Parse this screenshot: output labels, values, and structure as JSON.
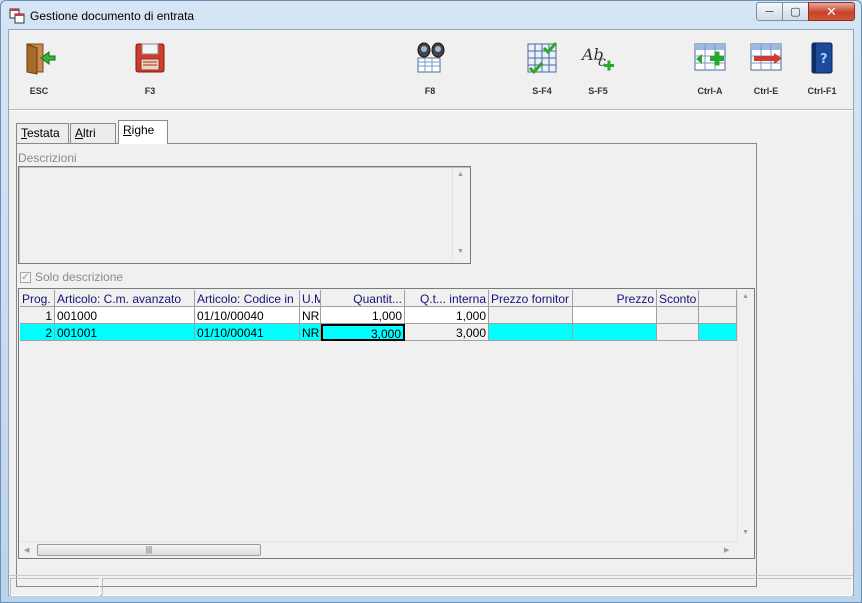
{
  "window": {
    "title": "Gestione documento di entrata",
    "minimize_glyph": "─",
    "maximize_glyph": "▢",
    "close_glyph": "✕"
  },
  "toolbar": {
    "buttons": [
      {
        "label": "ESC",
        "icon": "exit-door-icon"
      },
      {
        "label": "F3",
        "icon": "floppy-save-icon"
      },
      {
        "label": "F8",
        "icon": "binoculars-search-icon"
      },
      {
        "label": "S-F4",
        "icon": "grid-check-icon"
      },
      {
        "label": "S-F5",
        "icon": "spellcheck-add-icon"
      },
      {
        "label": "Ctrl-A",
        "icon": "add-row-icon"
      },
      {
        "label": "Ctrl-E",
        "icon": "delete-row-icon"
      },
      {
        "label": "Ctrl-F1",
        "icon": "help-book-icon"
      }
    ]
  },
  "tabs": [
    {
      "label": "Testata",
      "hotkey": "T",
      "rest": "estata"
    },
    {
      "label": "Altri",
      "hotkey": "A",
      "rest": "ltri"
    },
    {
      "label": "Righe",
      "hotkey": "R",
      "rest": "ighe",
      "active": true
    }
  ],
  "descrizioni": {
    "label": "Descrizioni",
    "value": ""
  },
  "solo_descrizione": {
    "label": "Solo descrizione",
    "checked": true
  },
  "grid": {
    "columns": [
      "Prog.",
      "Articolo: C.m. avanzato",
      "Articolo: Codice in",
      "U.M",
      "Quantit...",
      "Q.t... interna",
      "Prezzo fornitor",
      "Prezzo",
      "Sconto",
      ""
    ],
    "rows": [
      [
        "1",
        "001000",
        "01/10/00040",
        "NR",
        "1,000",
        "1,000",
        "",
        "",
        "",
        ""
      ],
      [
        "2",
        "001001",
        "01/10/00041",
        "NR",
        "3,000",
        "3,000",
        "",
        "",
        "",
        ""
      ]
    ],
    "scroll_up": "▲",
    "scroll_down": "▼",
    "scroll_left": "◀",
    "scroll_right": "▶",
    "thumb_grip": "|||"
  },
  "status": {
    "panel1": "",
    "panel2": ""
  }
}
